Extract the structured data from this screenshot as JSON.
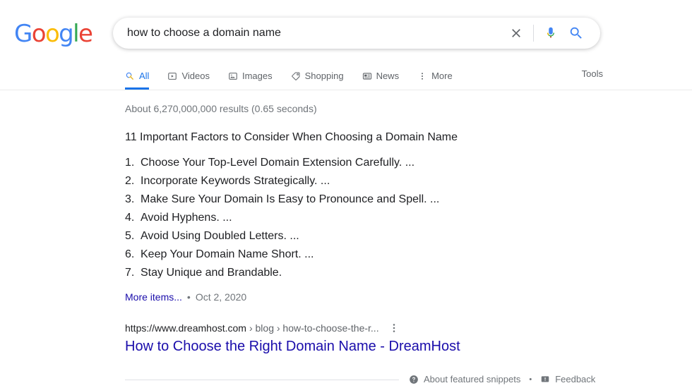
{
  "brand": {
    "name": "Google",
    "letters": [
      {
        "ch": "G",
        "color": "#4285f4"
      },
      {
        "ch": "o",
        "color": "#ea4335"
      },
      {
        "ch": "o",
        "color": "#fbbc05"
      },
      {
        "ch": "g",
        "color": "#4285f4"
      },
      {
        "ch": "l",
        "color": "#34a853"
      },
      {
        "ch": "e",
        "color": "#ea4335"
      }
    ]
  },
  "search": {
    "query": "how to choose a domain name",
    "placeholder": "Search",
    "clear_icon": "close-icon",
    "voice_icon": "microphone-icon",
    "submit_icon": "search-icon"
  },
  "nav": {
    "tabs": [
      {
        "label": "All",
        "icon": "search-icon",
        "active": true
      },
      {
        "label": "Videos",
        "icon": "video-icon",
        "active": false
      },
      {
        "label": "Images",
        "icon": "image-icon",
        "active": false
      },
      {
        "label": "Shopping",
        "icon": "tag-icon",
        "active": false
      },
      {
        "label": "News",
        "icon": "news-icon",
        "active": false
      },
      {
        "label": "More",
        "icon": "more-vertical-icon",
        "active": false
      }
    ],
    "tools_label": "Tools",
    "active_color": "#1a73e8"
  },
  "results": {
    "stats": "About 6,270,000,000 results (0.65 seconds)",
    "featured_snippet": {
      "heading": "11 Important Factors to Consider When Choosing a Domain Name",
      "items": [
        {
          "num": "1.",
          "text": "Choose Your Top-Level Domain Extension Carefully. ..."
        },
        {
          "num": "2.",
          "text": "Incorporate Keywords Strategically. ..."
        },
        {
          "num": "3.",
          "text": "Make Sure Your Domain Is Easy to Pronounce and Spell. ..."
        },
        {
          "num": "4.",
          "text": "Avoid Hyphens. ..."
        },
        {
          "num": "5.",
          "text": "Avoid Using Doubled Letters. ..."
        },
        {
          "num": "6.",
          "text": "Keep Your Domain Name Short. ..."
        },
        {
          "num": "7.",
          "text": "Stay Unique and Brandable."
        }
      ],
      "more_items_label": "More items...",
      "separator": "•",
      "date": "Oct 2, 2020",
      "source": {
        "domain": "https://www.dreamhost.com",
        "crumbs": "› blog › how-to-choose-the-r...",
        "menu_icon": "kebab-menu-icon",
        "title": "How to Choose the Right Domain Name - DreamHost",
        "link_color": "#1a0dab"
      },
      "footer": {
        "about_label": "About featured snippets",
        "about_icon": "help-circle-icon",
        "bullet": "•",
        "feedback_label": "Feedback",
        "feedback_icon": "feedback-icon"
      }
    }
  }
}
